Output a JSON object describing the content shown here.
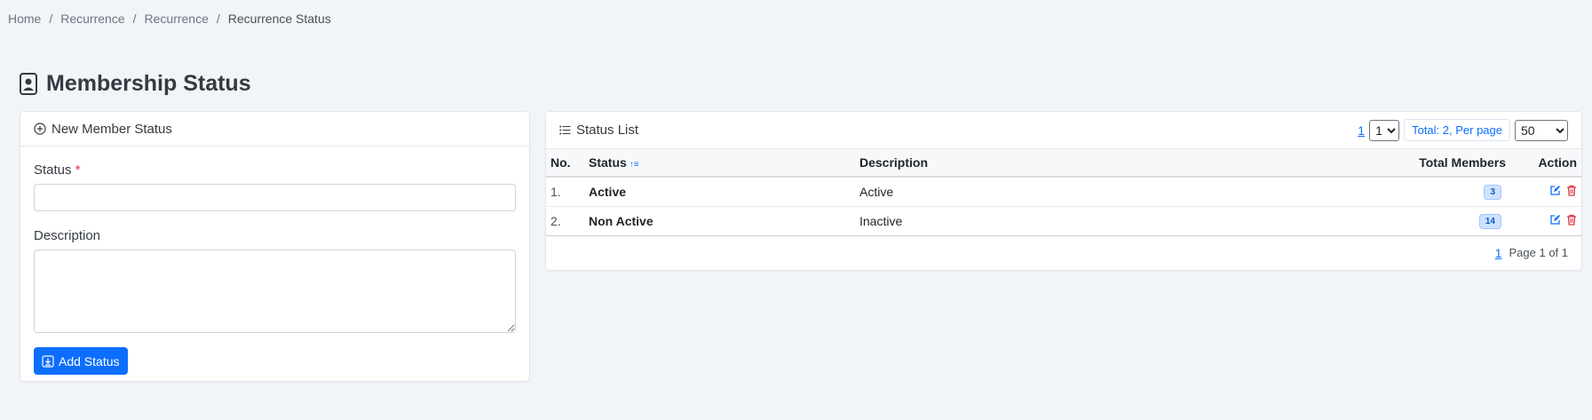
{
  "breadcrumb": [
    "Home",
    "Recurrence",
    "Recurrence",
    "Recurrence Status"
  ],
  "page_title": "Membership Status",
  "form": {
    "header": "New Member Status",
    "status_label": "Status",
    "required_mark": "*",
    "description_label": "Description",
    "status_value": "",
    "description_value": "",
    "submit_label": "Add Status"
  },
  "list": {
    "header": "Status List",
    "page_link": "1",
    "page_select": "1",
    "total_text": "Total: 2, Per page",
    "per_page": "50",
    "columns": {
      "no": "No.",
      "status": "Status",
      "description": "Description",
      "total_members": "Total Members",
      "action": "Action"
    },
    "rows": [
      {
        "no": "1.",
        "status": "Active",
        "description": "Active",
        "total": "3"
      },
      {
        "no": "2.",
        "status": "Non Active",
        "description": "Inactive",
        "total": "14"
      }
    ],
    "footer_page_link": "1",
    "footer_text": "Page 1 of 1"
  },
  "colors": {
    "primary": "#0d6efd",
    "danger": "#dc3545",
    "background": "#f1f4f9"
  },
  "icons": {
    "title": "contact-card-icon",
    "form_header": "plus-circle-icon",
    "list_header": "list-icon",
    "submit": "download-box-icon",
    "sort": "sort-asc-icon",
    "edit": "edit-icon",
    "delete": "trash-icon"
  }
}
